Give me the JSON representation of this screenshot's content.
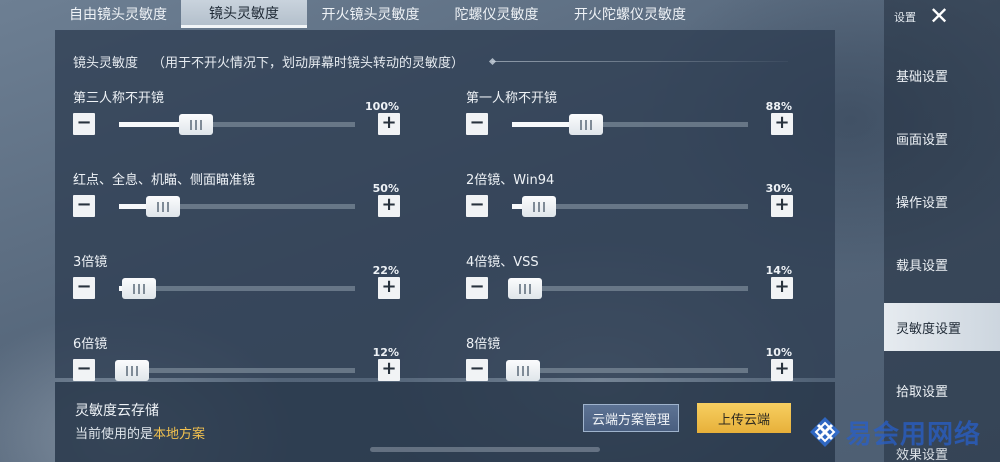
{
  "tabs": [
    {
      "label": "自由镜头灵敏度",
      "active": false
    },
    {
      "label": "镜头灵敏度",
      "active": true
    },
    {
      "label": "开火镜头灵敏度",
      "active": false
    },
    {
      "label": "陀螺仪灵敏度",
      "active": false
    },
    {
      "label": "开火陀螺仪灵敏度",
      "active": false
    }
  ],
  "section": {
    "title": "镜头灵敏度",
    "hint": "（用于不开火情况下，划动屏幕时镜头转动的灵敏度）"
  },
  "sliders": [
    {
      "label": "第三人称不开镜",
      "value_text": "100%",
      "level": 0.3
    },
    {
      "label": "第一人称不开镜",
      "value_text": "88%",
      "level": 0.29
    },
    {
      "label": "红点、全息、机瞄、侧面瞄准镜",
      "value_text": "50%",
      "level": 0.16
    },
    {
      "label": "2倍镜、Win94",
      "value_text": "30%",
      "level": 0.09
    },
    {
      "label": "3倍镜",
      "value_text": "22%",
      "level": 0.06
    },
    {
      "label": "4倍镜、VSS",
      "value_text": "14%",
      "level": 0.03
    },
    {
      "label": "6倍镜",
      "value_text": "12%",
      "level": 0.03
    },
    {
      "label": "8倍镜",
      "value_text": "10%",
      "level": 0.02
    }
  ],
  "controls": {
    "minus": "−",
    "plus": "+"
  },
  "cloud": {
    "title": "灵敏度云存储",
    "current_prefix": "当前使用的是",
    "current_value": "本地方案",
    "manage_label": "云端方案管理",
    "upload_label": "上传云端"
  },
  "sidebar": {
    "header": "设置",
    "close_glyph": "✕",
    "items": [
      {
        "label": "基础设置",
        "active": false
      },
      {
        "label": "画面设置",
        "active": false
      },
      {
        "label": "操作设置",
        "active": false
      },
      {
        "label": "载具设置",
        "active": false
      },
      {
        "label": "灵敏度设置",
        "active": true
      },
      {
        "label": "拾取设置",
        "active": false
      },
      {
        "label": "效果设置",
        "active": false
      }
    ]
  },
  "watermark": {
    "text": "易会用网络"
  },
  "colors": {
    "accent": "#f2c14f",
    "active_bg": "#e6ebf0"
  }
}
